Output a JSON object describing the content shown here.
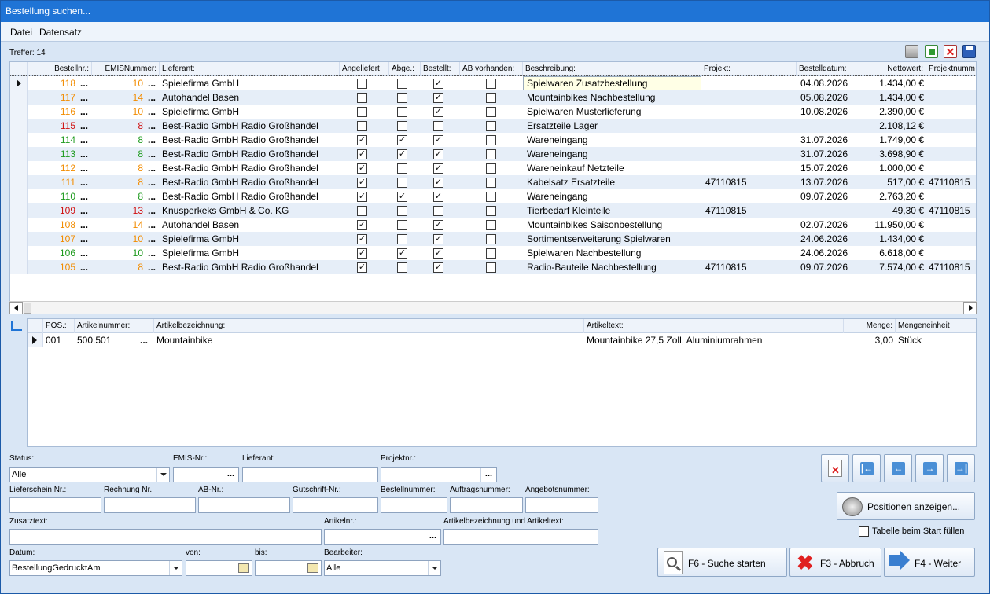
{
  "window": {
    "title": "Bestellung suchen..."
  },
  "menu": {
    "file": "Datei",
    "record": "Datensatz"
  },
  "hits_label": "Treffer: 14",
  "toolbar_icons": [
    "print-icon",
    "export-excel-icon",
    "delete-icon",
    "save-icon"
  ],
  "columns": [
    "Bestellnr.:",
    "EMISNummer:",
    "Lieferant:",
    "Angeliefert",
    "Abge.:",
    "Bestellt:",
    "AB vorhanden:",
    "Beschreibung:",
    "Projekt:",
    "Bestelldatum:",
    "Nettowert:",
    "Projektnumm"
  ],
  "colors": {
    "orange": "#f28c00",
    "green": "#1e9b1e",
    "red": "#d01010",
    "title": "#1f74d6"
  },
  "orders": [
    {
      "nr": "118",
      "emis": "10",
      "color": "orange",
      "supplier": "Spielefirma GmbH",
      "delivered": false,
      "picked": false,
      "ordered": true,
      "ab": false,
      "desc": "Spielwaren Zusatzbestellung",
      "project": "",
      "date": "04.08.2026",
      "net": "1.434,00 €",
      "projnr": ""
    },
    {
      "nr": "117",
      "emis": "14",
      "color": "orange",
      "supplier": "Autohandel Basen",
      "delivered": false,
      "picked": false,
      "ordered": true,
      "ab": false,
      "desc": "Mountainbikes Nachbestellung",
      "project": "",
      "date": "05.08.2026",
      "net": "1.434,00 €",
      "projnr": ""
    },
    {
      "nr": "116",
      "emis": "10",
      "color": "orange",
      "supplier": "Spielefirma GmbH",
      "delivered": false,
      "picked": false,
      "ordered": true,
      "ab": false,
      "desc": "Spielwaren Musterlieferung",
      "project": "",
      "date": "10.08.2026",
      "net": "2.390,00 €",
      "projnr": ""
    },
    {
      "nr": "115",
      "emis": "8",
      "color": "red",
      "supplier": "Best-Radio GmbH Radio Großhandel",
      "delivered": false,
      "picked": false,
      "ordered": false,
      "ab": false,
      "desc": "Ersatzteile Lager",
      "project": "",
      "date": "",
      "net": "2.108,12 €",
      "projnr": ""
    },
    {
      "nr": "114",
      "emis": "8",
      "color": "green",
      "supplier": "Best-Radio GmbH Radio Großhandel",
      "delivered": true,
      "picked": true,
      "ordered": true,
      "ab": false,
      "desc": "Wareneingang",
      "project": "",
      "date": "31.07.2026",
      "net": "1.749,00 €",
      "projnr": ""
    },
    {
      "nr": "113",
      "emis": "8",
      "color": "green",
      "supplier": "Best-Radio GmbH Radio Großhandel",
      "delivered": true,
      "picked": true,
      "ordered": true,
      "ab": false,
      "desc": "Wareneingang",
      "project": "",
      "date": "31.07.2026",
      "net": "3.698,90 €",
      "projnr": ""
    },
    {
      "nr": "112",
      "emis": "8",
      "color": "orange",
      "supplier": "Best-Radio GmbH Radio Großhandel",
      "delivered": true,
      "picked": false,
      "ordered": true,
      "ab": false,
      "desc": "Wareneinkauf Netzteile",
      "project": "",
      "date": "15.07.2026",
      "net": "1.000,00 €",
      "projnr": ""
    },
    {
      "nr": "111",
      "emis": "8",
      "color": "orange",
      "supplier": "Best-Radio GmbH Radio Großhandel",
      "delivered": true,
      "picked": false,
      "ordered": true,
      "ab": false,
      "desc": "Kabelsatz Ersatzteile",
      "project": "47110815",
      "date": "13.07.2026",
      "net": "517,00 €",
      "projnr": "47110815"
    },
    {
      "nr": "110",
      "emis": "8",
      "color": "green",
      "supplier": "Best-Radio GmbH Radio Großhandel",
      "delivered": true,
      "picked": true,
      "ordered": true,
      "ab": false,
      "desc": "Wareneingang",
      "project": "",
      "date": "09.07.2026",
      "net": "2.763,20 €",
      "projnr": ""
    },
    {
      "nr": "109",
      "emis": "13",
      "color": "red",
      "supplier": "Knusperkeks GmbH & Co. KG",
      "delivered": false,
      "picked": false,
      "ordered": false,
      "ab": false,
      "desc": "Tierbedarf Kleinteile",
      "project": "47110815",
      "date": "",
      "net": "49,30 €",
      "projnr": "47110815"
    },
    {
      "nr": "108",
      "emis": "14",
      "color": "orange",
      "supplier": "Autohandel Basen",
      "delivered": true,
      "picked": false,
      "ordered": true,
      "ab": false,
      "desc": "Mountainbikes Saisonbestellung",
      "project": "",
      "date": "02.07.2026",
      "net": "11.950,00 €",
      "projnr": ""
    },
    {
      "nr": "107",
      "emis": "10",
      "color": "orange",
      "supplier": "Spielefirma GmbH",
      "delivered": true,
      "picked": false,
      "ordered": true,
      "ab": false,
      "desc": "Sortimentserweiterung Spielwaren",
      "project": "",
      "date": "24.06.2026",
      "net": "1.434,00 €",
      "projnr": ""
    },
    {
      "nr": "106",
      "emis": "10",
      "color": "green",
      "supplier": "Spielefirma GmbH",
      "delivered": true,
      "picked": true,
      "ordered": true,
      "ab": false,
      "desc": "Spielwaren Nachbestellung",
      "project": "",
      "date": "24.06.2026",
      "net": "6.618,00 €",
      "projnr": ""
    },
    {
      "nr": "105",
      "emis": "8",
      "color": "orange",
      "supplier": "Best-Radio GmbH Radio Großhandel",
      "delivered": true,
      "picked": false,
      "ordered": true,
      "ab": false,
      "desc": "Radio-Bauteile Nachbestellung",
      "project": "47110815",
      "date": "09.07.2026",
      "net": "7.574,00 €",
      "projnr": "47110815"
    }
  ],
  "positions_columns": [
    "POS.:",
    "Artikelnummer:",
    "Artikelbezeichnung:",
    "Artikeltext:",
    "Menge:",
    "Mengeneinheit"
  ],
  "positions": [
    {
      "pos": "001",
      "artnr": "500.501",
      "name": "Mountainbike",
      "text": "Mountainbike 27,5 Zoll, Aluminiumrahmen",
      "qty": "3,00",
      "unit": "Stück"
    }
  ],
  "filters": {
    "status_label": "Status:",
    "status_value": "Alle",
    "emis_label": "EMIS-Nr.:",
    "supplier_label": "Lieferant:",
    "projnr_label": "Projektnr.:",
    "deliverynote_label": "Lieferschein Nr.:",
    "invoice_label": "Rechnung Nr.:",
    "ab_label": "AB-Nr.:",
    "credit_label": "Gutschrift-Nr.:",
    "ordernr_label": "Bestellnummer:",
    "jobnr_label": "Auftragsnummer:",
    "offernr_label": "Angebotsnummer:",
    "extratext_label": "Zusatztext:",
    "artnr_label": "Artikelnr.:",
    "artdesc_label": "Artikelbezeichnung und Artikeltext:",
    "date_label": "Datum:",
    "date_value": "BestellungGedrucktAm",
    "from_label": "von:",
    "to_label": "bis:",
    "editor_label": "Bearbeiter:",
    "editor_value": "Alle"
  },
  "buttons": {
    "show_positions": "Positionen anzeigen...",
    "fill_on_start": "Tabelle beim Start füllen",
    "search": "F6 - Suche starten",
    "cancel": "F3 - Abbruch",
    "next": "F4 - Weiter"
  }
}
